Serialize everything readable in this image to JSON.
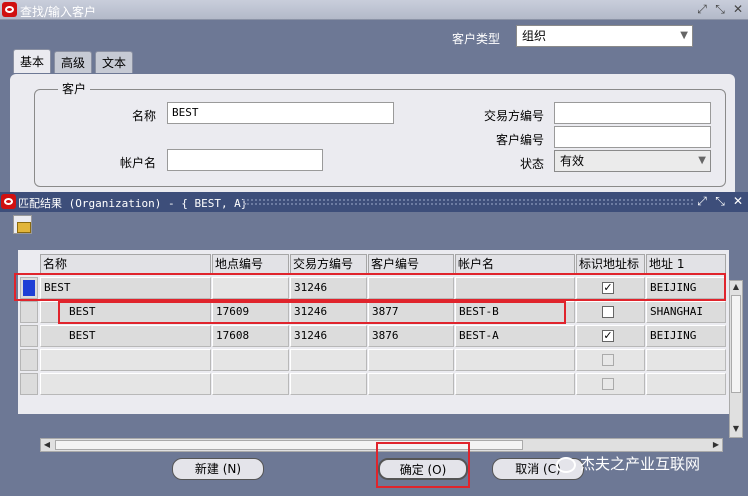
{
  "window": {
    "title": "查找/输入客户",
    "controls": [
      "⤢",
      "⤡",
      "✕"
    ]
  },
  "customer_type": {
    "label": "客户类型",
    "value": "组织"
  },
  "tabs": [
    {
      "label": "基本"
    },
    {
      "label": "高级"
    },
    {
      "label": "文本"
    }
  ],
  "customer_group": {
    "label": "客户",
    "name_label": "名称",
    "name_value": "BEST",
    "account_name_label": "帐户名",
    "account_name_value": "",
    "trading_party_label": "交易方编号",
    "trading_party_value": "",
    "customer_number_label": "客户编号",
    "customer_number_value": "",
    "status_label": "状态",
    "status_value": "有效"
  },
  "results": {
    "title": "匹配结果 (Organization) - { BEST, A}",
    "columns": [
      "名称",
      "地点编号",
      "交易方编号",
      "客户编号",
      "帐户名",
      "标识地址标",
      "地址 1"
    ],
    "rows": [
      {
        "name": "BEST",
        "site": "",
        "party": "31246",
        "customer": "",
        "account": "",
        "flag": true,
        "address": "BEIJING"
      },
      {
        "name": "BEST",
        "site": "17609",
        "party": "31246",
        "customer": "3877",
        "account": "BEST-B",
        "flag": false,
        "address": "SHANGHAI"
      },
      {
        "name": "BEST",
        "site": "17608",
        "party": "31246",
        "customer": "3876",
        "account": "BEST-A",
        "flag": true,
        "address": "BEIJING"
      }
    ]
  },
  "buttons": {
    "new": "新建 (N)",
    "ok": "确定 (O)",
    "cancel": "取消 (C)"
  },
  "watermark": "杰夫之产业互联网",
  "colors": {
    "panel": "#6d7895",
    "title_active": "#3d4e7a",
    "highlight": "#e0242c",
    "row_marker": "#1e3fd6"
  }
}
